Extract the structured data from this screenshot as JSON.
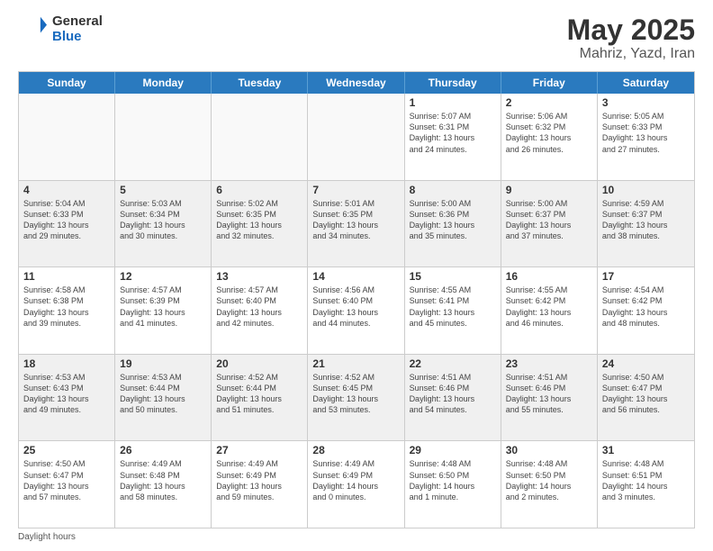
{
  "header": {
    "logo_general": "General",
    "logo_blue": "Blue",
    "title": "May 2025",
    "location": "Mahriz, Yazd, Iran"
  },
  "days_of_week": [
    "Sunday",
    "Monday",
    "Tuesday",
    "Wednesday",
    "Thursday",
    "Friday",
    "Saturday"
  ],
  "weeks": [
    [
      {
        "day": "",
        "info": "",
        "empty": true
      },
      {
        "day": "",
        "info": "",
        "empty": true
      },
      {
        "day": "",
        "info": "",
        "empty": true
      },
      {
        "day": "",
        "info": "",
        "empty": true
      },
      {
        "day": "1",
        "info": "Sunrise: 5:07 AM\nSunset: 6:31 PM\nDaylight: 13 hours\nand 24 minutes.",
        "empty": false
      },
      {
        "day": "2",
        "info": "Sunrise: 5:06 AM\nSunset: 6:32 PM\nDaylight: 13 hours\nand 26 minutes.",
        "empty": false
      },
      {
        "day": "3",
        "info": "Sunrise: 5:05 AM\nSunset: 6:33 PM\nDaylight: 13 hours\nand 27 minutes.",
        "empty": false
      }
    ],
    [
      {
        "day": "4",
        "info": "Sunrise: 5:04 AM\nSunset: 6:33 PM\nDaylight: 13 hours\nand 29 minutes.",
        "empty": false
      },
      {
        "day": "5",
        "info": "Sunrise: 5:03 AM\nSunset: 6:34 PM\nDaylight: 13 hours\nand 30 minutes.",
        "empty": false
      },
      {
        "day": "6",
        "info": "Sunrise: 5:02 AM\nSunset: 6:35 PM\nDaylight: 13 hours\nand 32 minutes.",
        "empty": false
      },
      {
        "day": "7",
        "info": "Sunrise: 5:01 AM\nSunset: 6:35 PM\nDaylight: 13 hours\nand 34 minutes.",
        "empty": false
      },
      {
        "day": "8",
        "info": "Sunrise: 5:00 AM\nSunset: 6:36 PM\nDaylight: 13 hours\nand 35 minutes.",
        "empty": false
      },
      {
        "day": "9",
        "info": "Sunrise: 5:00 AM\nSunset: 6:37 PM\nDaylight: 13 hours\nand 37 minutes.",
        "empty": false
      },
      {
        "day": "10",
        "info": "Sunrise: 4:59 AM\nSunset: 6:37 PM\nDaylight: 13 hours\nand 38 minutes.",
        "empty": false
      }
    ],
    [
      {
        "day": "11",
        "info": "Sunrise: 4:58 AM\nSunset: 6:38 PM\nDaylight: 13 hours\nand 39 minutes.",
        "empty": false
      },
      {
        "day": "12",
        "info": "Sunrise: 4:57 AM\nSunset: 6:39 PM\nDaylight: 13 hours\nand 41 minutes.",
        "empty": false
      },
      {
        "day": "13",
        "info": "Sunrise: 4:57 AM\nSunset: 6:40 PM\nDaylight: 13 hours\nand 42 minutes.",
        "empty": false
      },
      {
        "day": "14",
        "info": "Sunrise: 4:56 AM\nSunset: 6:40 PM\nDaylight: 13 hours\nand 44 minutes.",
        "empty": false
      },
      {
        "day": "15",
        "info": "Sunrise: 4:55 AM\nSunset: 6:41 PM\nDaylight: 13 hours\nand 45 minutes.",
        "empty": false
      },
      {
        "day": "16",
        "info": "Sunrise: 4:55 AM\nSunset: 6:42 PM\nDaylight: 13 hours\nand 46 minutes.",
        "empty": false
      },
      {
        "day": "17",
        "info": "Sunrise: 4:54 AM\nSunset: 6:42 PM\nDaylight: 13 hours\nand 48 minutes.",
        "empty": false
      }
    ],
    [
      {
        "day": "18",
        "info": "Sunrise: 4:53 AM\nSunset: 6:43 PM\nDaylight: 13 hours\nand 49 minutes.",
        "empty": false
      },
      {
        "day": "19",
        "info": "Sunrise: 4:53 AM\nSunset: 6:44 PM\nDaylight: 13 hours\nand 50 minutes.",
        "empty": false
      },
      {
        "day": "20",
        "info": "Sunrise: 4:52 AM\nSunset: 6:44 PM\nDaylight: 13 hours\nand 51 minutes.",
        "empty": false
      },
      {
        "day": "21",
        "info": "Sunrise: 4:52 AM\nSunset: 6:45 PM\nDaylight: 13 hours\nand 53 minutes.",
        "empty": false
      },
      {
        "day": "22",
        "info": "Sunrise: 4:51 AM\nSunset: 6:46 PM\nDaylight: 13 hours\nand 54 minutes.",
        "empty": false
      },
      {
        "day": "23",
        "info": "Sunrise: 4:51 AM\nSunset: 6:46 PM\nDaylight: 13 hours\nand 55 minutes.",
        "empty": false
      },
      {
        "day": "24",
        "info": "Sunrise: 4:50 AM\nSunset: 6:47 PM\nDaylight: 13 hours\nand 56 minutes.",
        "empty": false
      }
    ],
    [
      {
        "day": "25",
        "info": "Sunrise: 4:50 AM\nSunset: 6:47 PM\nDaylight: 13 hours\nand 57 minutes.",
        "empty": false
      },
      {
        "day": "26",
        "info": "Sunrise: 4:49 AM\nSunset: 6:48 PM\nDaylight: 13 hours\nand 58 minutes.",
        "empty": false
      },
      {
        "day": "27",
        "info": "Sunrise: 4:49 AM\nSunset: 6:49 PM\nDaylight: 13 hours\nand 59 minutes.",
        "empty": false
      },
      {
        "day": "28",
        "info": "Sunrise: 4:49 AM\nSunset: 6:49 PM\nDaylight: 14 hours\nand 0 minutes.",
        "empty": false
      },
      {
        "day": "29",
        "info": "Sunrise: 4:48 AM\nSunset: 6:50 PM\nDaylight: 14 hours\nand 1 minute.",
        "empty": false
      },
      {
        "day": "30",
        "info": "Sunrise: 4:48 AM\nSunset: 6:50 PM\nDaylight: 14 hours\nand 2 minutes.",
        "empty": false
      },
      {
        "day": "31",
        "info": "Sunrise: 4:48 AM\nSunset: 6:51 PM\nDaylight: 14 hours\nand 3 minutes.",
        "empty": false
      }
    ]
  ],
  "footer": "Daylight hours"
}
